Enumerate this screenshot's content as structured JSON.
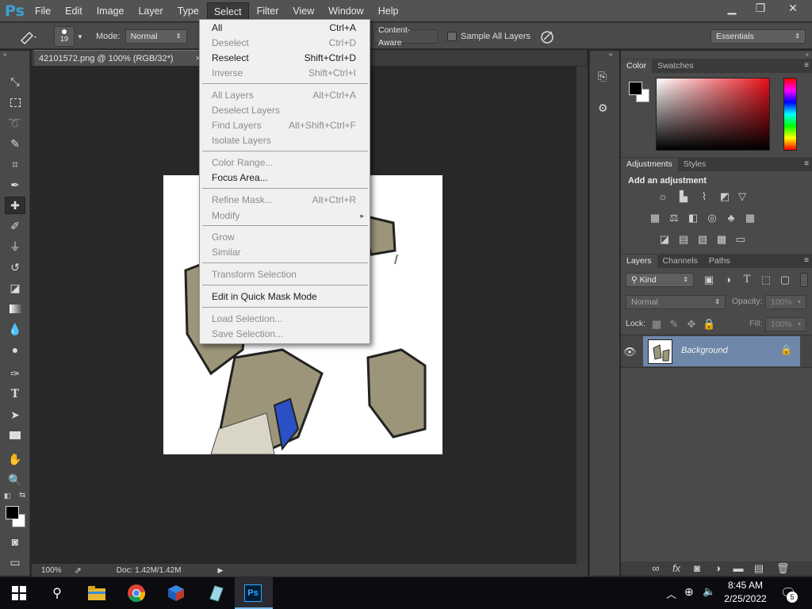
{
  "app": {
    "logo": "Ps"
  },
  "menubar": {
    "items": [
      "File",
      "Edit",
      "Image",
      "Layer",
      "Type",
      "Select",
      "Filter",
      "View",
      "Window",
      "Help"
    ],
    "active": "Select"
  },
  "window_controls": {
    "minimize": "▁",
    "restore": "❐",
    "close": "✕"
  },
  "options": {
    "brush_size": "19",
    "mode_label": "Mode:",
    "mode_value": "Normal",
    "content_aware": "Content-Aware",
    "sample_all_layers": "Sample All Layers",
    "workspace": "Essentials"
  },
  "document": {
    "tab_title": "42101572.png @ 100% (RGB/32*)",
    "tab_close": "×"
  },
  "status": {
    "zoom": "100%",
    "doc": "Doc: 1.42M/1.42M"
  },
  "select_menu": {
    "items": [
      {
        "label": "All",
        "shortcut": "Ctrl+A",
        "enabled": true
      },
      {
        "label": "Deselect",
        "shortcut": "Ctrl+D",
        "enabled": false
      },
      {
        "label": "Reselect",
        "shortcut": "Shift+Ctrl+D",
        "enabled": true
      },
      {
        "label": "Inverse",
        "shortcut": "Shift+Ctrl+I",
        "enabled": false
      },
      {
        "label": "All Layers",
        "shortcut": "Alt+Ctrl+A",
        "enabled": false
      },
      {
        "label": "Deselect Layers",
        "shortcut": "",
        "enabled": false
      },
      {
        "label": "Find Layers",
        "shortcut": "Alt+Shift+Ctrl+F",
        "enabled": false
      },
      {
        "label": "Isolate Layers",
        "shortcut": "",
        "enabled": false
      },
      {
        "label": "Color Range...",
        "shortcut": "",
        "enabled": false
      },
      {
        "label": "Focus Area...",
        "shortcut": "",
        "enabled": true
      },
      {
        "label": "Refine Mask...",
        "shortcut": "Alt+Ctrl+R",
        "enabled": false
      },
      {
        "label": "Modify",
        "shortcut": "▸",
        "enabled": false
      },
      {
        "label": "Grow",
        "shortcut": "",
        "enabled": false
      },
      {
        "label": "Similar",
        "shortcut": "",
        "enabled": false
      },
      {
        "label": "Transform Selection",
        "shortcut": "",
        "enabled": false
      },
      {
        "label": "Edit in Quick Mask Mode",
        "shortcut": "",
        "enabled": true
      },
      {
        "label": "Load Selection...",
        "shortcut": "",
        "enabled": false
      },
      {
        "label": "Save Selection...",
        "shortcut": "",
        "enabled": false
      }
    ]
  },
  "panels": {
    "color": {
      "tabs": [
        "Color",
        "Swatches"
      ]
    },
    "adjustments": {
      "tabs": [
        "Adjustments",
        "Styles"
      ],
      "heading": "Add an adjustment"
    },
    "layers": {
      "tabs": [
        "Layers",
        "Channels",
        "Paths"
      ],
      "kind": "Kind",
      "blend": "Normal",
      "opacity_label": "Opacity:",
      "opacity_value": "100%",
      "lock_label": "Lock:",
      "fill_label": "Fill:",
      "fill_value": "100%",
      "layer_name": "Background"
    }
  },
  "taskbar": {
    "time": "8:45 AM",
    "date": "2/25/2022",
    "notifications": "5"
  },
  "colors": {
    "accent": "#3d9fd6",
    "selected_layer": "#6f87a9",
    "fg": "#000000",
    "bg": "#ffffff"
  }
}
